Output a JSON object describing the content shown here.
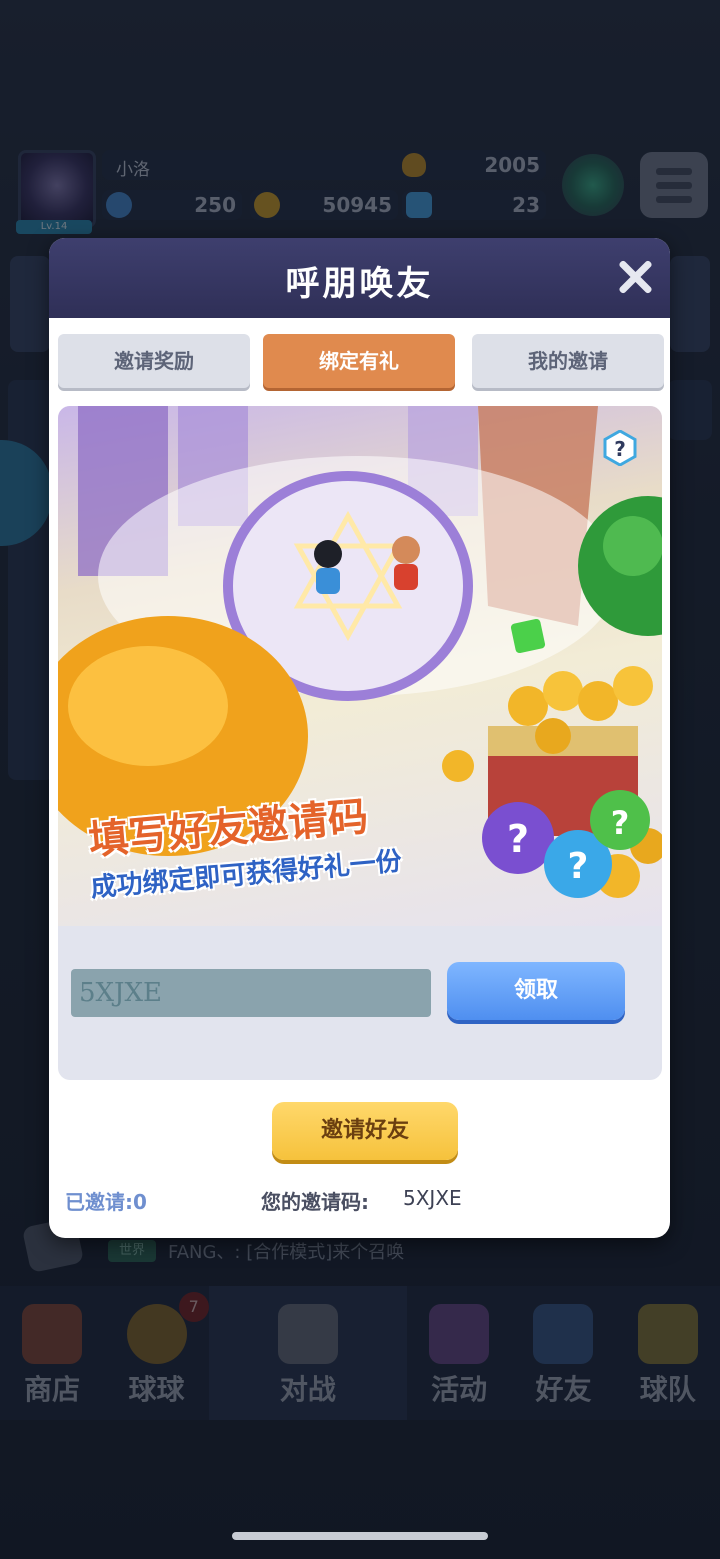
{
  "hud": {
    "avatar_level": "Lv.14",
    "player_name": "小洛",
    "trophies": "2005",
    "resources": [
      {
        "name": "energy",
        "value": "250",
        "color": "#4a8fd8"
      },
      {
        "name": "gold",
        "value": "50945",
        "color": "#d8a42b"
      },
      {
        "name": "gem",
        "value": "23",
        "color": "#4aa6e8"
      }
    ]
  },
  "modal": {
    "title": "呼朋唤友",
    "tabs": [
      {
        "label": "邀请奖励",
        "active": false
      },
      {
        "label": "绑定有礼",
        "active": true
      },
      {
        "label": "我的邀请",
        "active": false
      }
    ],
    "banner": {
      "headline": "填写好友邀请码",
      "subline": "成功绑定即可获得好礼一份"
    },
    "code_input": {
      "value": "5XJXE",
      "placeholder": ""
    },
    "claim_label": "领取",
    "invite_label": "邀请好友",
    "invited_count": "已邀请:0",
    "code_label": "您的邀请码:",
    "code_value": "5XJXE"
  },
  "chat": {
    "tag": "世界",
    "message": "FANG、: [合作模式]来个召唤"
  },
  "nav": {
    "items": [
      {
        "label": "商店",
        "icon": "shop-icon"
      },
      {
        "label": "球球",
        "icon": "balls-icon",
        "badge": "7"
      },
      {
        "label": "对战",
        "icon": "battle-icon"
      },
      {
        "label": "活动",
        "icon": "events-icon"
      },
      {
        "label": "好友",
        "icon": "friends-icon"
      },
      {
        "label": "球队",
        "icon": "team-icon"
      }
    ]
  },
  "colors": {
    "modal_header": "#3e3f6e",
    "active_tab": "#e08a4e",
    "claim_button": "#4f8ff0",
    "invite_button": "#f6c23c"
  }
}
